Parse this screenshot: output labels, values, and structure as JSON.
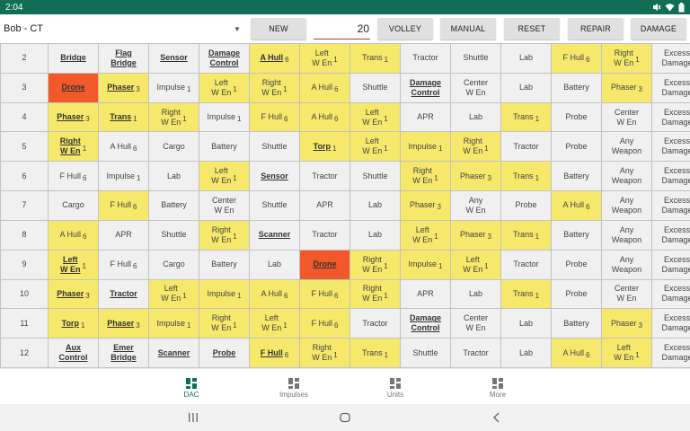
{
  "status_bar": {
    "time": "2:04"
  },
  "toolbar": {
    "player": "Bob - CT",
    "new_label": "NEW",
    "volley_value": "20",
    "volley_label": "VOLLEY",
    "manual_label": "MANUAL",
    "reset_label": "RESET",
    "repair_label": "REPAIR",
    "damage_label": "DAMAGE"
  },
  "grid": {
    "rows": [
      {
        "num": "2",
        "cells": [
          {
            "t": "Bridge",
            "s": "",
            "c": "g",
            "b": true
          },
          {
            "t": "Flag\nBridge",
            "s": "",
            "c": "g",
            "b": true
          },
          {
            "t": "Sensor",
            "s": "",
            "c": "g",
            "b": true
          },
          {
            "t": "Damage\nControl",
            "s": "",
            "c": "g",
            "b": true
          },
          {
            "t": "A Hull",
            "s": "6",
            "c": "y",
            "b": true
          },
          {
            "t": "Left\nW En",
            "s": "1",
            "c": "y",
            "b": false
          },
          {
            "t": "Trans",
            "s": "1",
            "c": "y",
            "b": false
          },
          {
            "t": "Tractor",
            "s": "",
            "c": "g",
            "b": false
          },
          {
            "t": "Shuttle",
            "s": "",
            "c": "g",
            "b": false
          },
          {
            "t": "Lab",
            "s": "",
            "c": "g",
            "b": false
          },
          {
            "t": "F Hull",
            "s": "6",
            "c": "y",
            "b": false
          },
          {
            "t": "Right\nW En",
            "s": "1",
            "c": "y",
            "b": false
          },
          {
            "t": "Excess\nDamage",
            "s": "",
            "c": "g",
            "b": false
          }
        ]
      },
      {
        "num": "3",
        "cells": [
          {
            "t": "Drone",
            "s": "",
            "c": "o",
            "b": true
          },
          {
            "t": "Phaser",
            "s": "3",
            "c": "y",
            "b": true
          },
          {
            "t": "Impulse",
            "s": "1",
            "c": "g",
            "b": false
          },
          {
            "t": "Left\nW En",
            "s": "1",
            "c": "y",
            "b": false
          },
          {
            "t": "Right\nW En",
            "s": "1",
            "c": "y",
            "b": false
          },
          {
            "t": "A Hull",
            "s": "6",
            "c": "y",
            "b": false
          },
          {
            "t": "Shuttle",
            "s": "",
            "c": "g",
            "b": false
          },
          {
            "t": "Damage\nControl",
            "s": "",
            "c": "g",
            "b": true
          },
          {
            "t": "Center\nW En",
            "s": "",
            "c": "g",
            "b": false
          },
          {
            "t": "Lab",
            "s": "",
            "c": "g",
            "b": false
          },
          {
            "t": "Battery",
            "s": "",
            "c": "g",
            "b": false
          },
          {
            "t": "Phaser",
            "s": "3",
            "c": "y",
            "b": false
          },
          {
            "t": "Excess\nDamage",
            "s": "",
            "c": "g",
            "b": false
          }
        ]
      },
      {
        "num": "4",
        "cells": [
          {
            "t": "Phaser",
            "s": "3",
            "c": "y",
            "b": true
          },
          {
            "t": "Trans",
            "s": "1",
            "c": "y",
            "b": true
          },
          {
            "t": "Right\nW En",
            "s": "1",
            "c": "y",
            "b": false
          },
          {
            "t": "Impulse",
            "s": "1",
            "c": "g",
            "b": false
          },
          {
            "t": "F Hull",
            "s": "6",
            "c": "y",
            "b": false
          },
          {
            "t": "A Hull",
            "s": "6",
            "c": "y",
            "b": false
          },
          {
            "t": "Left\nW En",
            "s": "1",
            "c": "y",
            "b": false
          },
          {
            "t": "APR",
            "s": "",
            "c": "g",
            "b": false
          },
          {
            "t": "Lab",
            "s": "",
            "c": "g",
            "b": false
          },
          {
            "t": "Trans",
            "s": "1",
            "c": "y",
            "b": false
          },
          {
            "t": "Probe",
            "s": "",
            "c": "g",
            "b": false
          },
          {
            "t": "Center\nW En",
            "s": "",
            "c": "g",
            "b": false
          },
          {
            "t": "Excess\nDamage",
            "s": "",
            "c": "g",
            "b": false
          }
        ]
      },
      {
        "num": "5",
        "cells": [
          {
            "t": "Right\nW En",
            "s": "1",
            "c": "y",
            "b": true
          },
          {
            "t": "A Hull",
            "s": "6",
            "c": "g",
            "b": false
          },
          {
            "t": "Cargo",
            "s": "",
            "c": "g",
            "b": false
          },
          {
            "t": "Battery",
            "s": "",
            "c": "g",
            "b": false
          },
          {
            "t": "Shuttle",
            "s": "",
            "c": "g",
            "b": false
          },
          {
            "t": "Torp",
            "s": "1",
            "c": "y",
            "b": true
          },
          {
            "t": "Left\nW En",
            "s": "1",
            "c": "y",
            "b": false
          },
          {
            "t": "Impulse",
            "s": "1",
            "c": "y",
            "b": false
          },
          {
            "t": "Right\nW En",
            "s": "1",
            "c": "y",
            "b": false
          },
          {
            "t": "Tractor",
            "s": "",
            "c": "g",
            "b": false
          },
          {
            "t": "Probe",
            "s": "",
            "c": "g",
            "b": false
          },
          {
            "t": "Any\nWeapon",
            "s": "",
            "c": "g",
            "b": false
          },
          {
            "t": "Excess\nDamage",
            "s": "",
            "c": "g",
            "b": false
          }
        ]
      },
      {
        "num": "6",
        "cells": [
          {
            "t": "F Hull",
            "s": "6",
            "c": "g",
            "b": false
          },
          {
            "t": "Impulse",
            "s": "1",
            "c": "g",
            "b": false
          },
          {
            "t": "Lab",
            "s": "",
            "c": "g",
            "b": false
          },
          {
            "t": "Left\nW En",
            "s": "1",
            "c": "y",
            "b": false
          },
          {
            "t": "Sensor",
            "s": "",
            "c": "g",
            "b": true
          },
          {
            "t": "Tractor",
            "s": "",
            "c": "g",
            "b": false
          },
          {
            "t": "Shuttle",
            "s": "",
            "c": "g",
            "b": false
          },
          {
            "t": "Right\nW En",
            "s": "1",
            "c": "y",
            "b": false
          },
          {
            "t": "Phaser",
            "s": "3",
            "c": "y",
            "b": false
          },
          {
            "t": "Trans",
            "s": "1",
            "c": "y",
            "b": false
          },
          {
            "t": "Battery",
            "s": "",
            "c": "g",
            "b": false
          },
          {
            "t": "Any\nWeapon",
            "s": "",
            "c": "g",
            "b": false
          },
          {
            "t": "Excess\nDamage",
            "s": "",
            "c": "g",
            "b": false
          }
        ]
      },
      {
        "num": "7",
        "cells": [
          {
            "t": "Cargo",
            "s": "",
            "c": "g",
            "b": false
          },
          {
            "t": "F Hull",
            "s": "6",
            "c": "y",
            "b": false
          },
          {
            "t": "Battery",
            "s": "",
            "c": "g",
            "b": false
          },
          {
            "t": "Center\nW En",
            "s": "",
            "c": "g",
            "b": false
          },
          {
            "t": "Shuttle",
            "s": "",
            "c": "g",
            "b": false
          },
          {
            "t": "APR",
            "s": "",
            "c": "g",
            "b": false
          },
          {
            "t": "Lab",
            "s": "",
            "c": "g",
            "b": false
          },
          {
            "t": "Phaser",
            "s": "3",
            "c": "y",
            "b": false
          },
          {
            "t": "Any\nW En",
            "s": "",
            "c": "g",
            "b": false
          },
          {
            "t": "Probe",
            "s": "",
            "c": "g",
            "b": false
          },
          {
            "t": "A Hull",
            "s": "6",
            "c": "y",
            "b": false
          },
          {
            "t": "Any\nWeapon",
            "s": "",
            "c": "g",
            "b": false
          },
          {
            "t": "Excess\nDamage",
            "s": "",
            "c": "g",
            "b": false
          }
        ]
      },
      {
        "num": "8",
        "cells": [
          {
            "t": "A Hull",
            "s": "6",
            "c": "y",
            "b": false
          },
          {
            "t": "APR",
            "s": "",
            "c": "g",
            "b": false
          },
          {
            "t": "Shuttle",
            "s": "",
            "c": "g",
            "b": false
          },
          {
            "t": "Right\nW En",
            "s": "1",
            "c": "y",
            "b": false
          },
          {
            "t": "Scanner",
            "s": "",
            "c": "g",
            "b": true
          },
          {
            "t": "Tractor",
            "s": "",
            "c": "g",
            "b": false
          },
          {
            "t": "Lab",
            "s": "",
            "c": "g",
            "b": false
          },
          {
            "t": "Left\nW En",
            "s": "1",
            "c": "y",
            "b": false
          },
          {
            "t": "Phaser",
            "s": "3",
            "c": "y",
            "b": false
          },
          {
            "t": "Trans",
            "s": "1",
            "c": "y",
            "b": false
          },
          {
            "t": "Battery",
            "s": "",
            "c": "g",
            "b": false
          },
          {
            "t": "Any\nWeapon",
            "s": "",
            "c": "g",
            "b": false
          },
          {
            "t": "Excess\nDamage",
            "s": "",
            "c": "g",
            "b": false
          }
        ]
      },
      {
        "num": "9",
        "cells": [
          {
            "t": "Left\nW En",
            "s": "1",
            "c": "y",
            "b": true
          },
          {
            "t": "F Hull",
            "s": "6",
            "c": "g",
            "b": false
          },
          {
            "t": "Cargo",
            "s": "",
            "c": "g",
            "b": false
          },
          {
            "t": "Battery",
            "s": "",
            "c": "g",
            "b": false
          },
          {
            "t": "Lab",
            "s": "",
            "c": "g",
            "b": false
          },
          {
            "t": "Drone",
            "s": "",
            "c": "o",
            "b": true
          },
          {
            "t": "Right\nW En",
            "s": "1",
            "c": "y",
            "b": false
          },
          {
            "t": "Impulse",
            "s": "1",
            "c": "y",
            "b": false
          },
          {
            "t": "Left\nW En",
            "s": "1",
            "c": "y",
            "b": false
          },
          {
            "t": "Tractor",
            "s": "",
            "c": "g",
            "b": false
          },
          {
            "t": "Probe",
            "s": "",
            "c": "g",
            "b": false
          },
          {
            "t": "Any\nWeapon",
            "s": "",
            "c": "g",
            "b": false
          },
          {
            "t": "Excess\nDamage",
            "s": "",
            "c": "g",
            "b": false
          }
        ]
      },
      {
        "num": "10",
        "cells": [
          {
            "t": "Phaser",
            "s": "3",
            "c": "y",
            "b": true
          },
          {
            "t": "Tractor",
            "s": "",
            "c": "g",
            "b": true
          },
          {
            "t": "Left\nW En",
            "s": "1",
            "c": "y",
            "b": false
          },
          {
            "t": "Impulse",
            "s": "1",
            "c": "y",
            "b": false
          },
          {
            "t": "A Hull",
            "s": "6",
            "c": "y",
            "b": false
          },
          {
            "t": "F Hull",
            "s": "6",
            "c": "y",
            "b": false
          },
          {
            "t": "Right\nW En",
            "s": "1",
            "c": "y",
            "b": false
          },
          {
            "t": "APR",
            "s": "",
            "c": "g",
            "b": false
          },
          {
            "t": "Lab",
            "s": "",
            "c": "g",
            "b": false
          },
          {
            "t": "Trans",
            "s": "1",
            "c": "y",
            "b": false
          },
          {
            "t": "Probe",
            "s": "",
            "c": "g",
            "b": false
          },
          {
            "t": "Center\nW En",
            "s": "",
            "c": "g",
            "b": false
          },
          {
            "t": "Excess\nDamage",
            "s": "",
            "c": "g",
            "b": false
          }
        ]
      },
      {
        "num": "11",
        "cells": [
          {
            "t": "Torp",
            "s": "1",
            "c": "y",
            "b": true
          },
          {
            "t": "Phaser",
            "s": "3",
            "c": "y",
            "b": true
          },
          {
            "t": "Impulse",
            "s": "1",
            "c": "y",
            "b": false
          },
          {
            "t": "Right\nW En",
            "s": "1",
            "c": "y",
            "b": false
          },
          {
            "t": "Left\nW En",
            "s": "1",
            "c": "y",
            "b": false
          },
          {
            "t": "F Hull",
            "s": "6",
            "c": "y",
            "b": false
          },
          {
            "t": "Tractor",
            "s": "",
            "c": "g",
            "b": false
          },
          {
            "t": "Damage\nControl",
            "s": "",
            "c": "g",
            "b": true
          },
          {
            "t": "Center\nW En",
            "s": "",
            "c": "g",
            "b": false
          },
          {
            "t": "Lab",
            "s": "",
            "c": "g",
            "b": false
          },
          {
            "t": "Battery",
            "s": "",
            "c": "g",
            "b": false
          },
          {
            "t": "Phaser",
            "s": "3",
            "c": "y",
            "b": false
          },
          {
            "t": "Excess\nDamage",
            "s": "",
            "c": "g",
            "b": false
          }
        ]
      },
      {
        "num": "12",
        "cells": [
          {
            "t": "Aux\nControl",
            "s": "",
            "c": "g",
            "b": true
          },
          {
            "t": "Emer\nBridge",
            "s": "",
            "c": "g",
            "b": true
          },
          {
            "t": "Scanner",
            "s": "",
            "c": "g",
            "b": true
          },
          {
            "t": "Probe",
            "s": "",
            "c": "g",
            "b": true
          },
          {
            "t": "F Hull",
            "s": "6",
            "c": "y",
            "b": true
          },
          {
            "t": "Right\nW En",
            "s": "1",
            "c": "y",
            "b": false
          },
          {
            "t": "Trans",
            "s": "1",
            "c": "y",
            "b": false
          },
          {
            "t": "Shuttle",
            "s": "",
            "c": "g",
            "b": false
          },
          {
            "t": "Tractor",
            "s": "",
            "c": "g",
            "b": false
          },
          {
            "t": "Lab",
            "s": "",
            "c": "g",
            "b": false
          },
          {
            "t": "A Hull",
            "s": "6",
            "c": "y",
            "b": false
          },
          {
            "t": "Left\nW En",
            "s": "1",
            "c": "y",
            "b": false
          },
          {
            "t": "Excess\nDamage",
            "s": "",
            "c": "g",
            "b": false
          }
        ]
      }
    ]
  },
  "bottom_nav": {
    "dac": "DAC",
    "impulses": "Impulses",
    "units": "Units",
    "more": "More"
  },
  "colors": {
    "accent": "#0f6e54",
    "yellow_cell": "#f5e86a",
    "orange_cell": "#f2592a",
    "gray_cell": "#f0f0f0"
  }
}
